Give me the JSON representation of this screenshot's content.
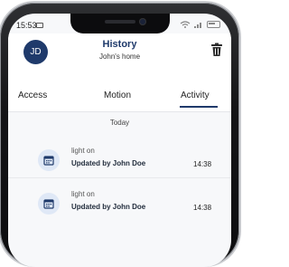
{
  "status_bar": {
    "time": "15:53"
  },
  "header": {
    "avatar_initials": "JD",
    "title": "History",
    "subtitle": "John's home"
  },
  "tabs": [
    {
      "label": "Access",
      "active": false
    },
    {
      "label": "Motion",
      "active": false
    },
    {
      "label": "Activity",
      "active": true
    }
  ],
  "section": {
    "label": "Today"
  },
  "items": [
    {
      "title": "light on",
      "subtitle": "Updated by John Doe",
      "time": "14:38",
      "icon": "calendar-icon"
    },
    {
      "title": "light on",
      "subtitle": "Updated by John Doe",
      "time": "14:38",
      "icon": "calendar-icon"
    }
  ],
  "colors": {
    "accent": "#1f3a6b",
    "icon_bg": "#dfe8f6",
    "background": "#f7f8fa"
  }
}
